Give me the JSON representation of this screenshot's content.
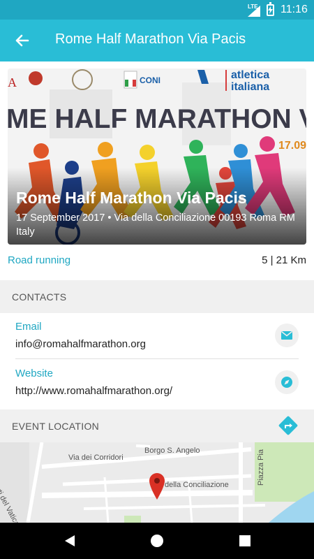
{
  "status_bar": {
    "network": "LTE",
    "time": "11:16"
  },
  "app_bar": {
    "title": "Rome Half Marathon Via Pacis"
  },
  "hero": {
    "banner_text": "ME HALF MARATHON VIA PA",
    "banner_date": "17.09",
    "logo_text_1": "atletica",
    "logo_text_2": "italiana",
    "logo_coni": "CONI",
    "event_title": "Rome Half Marathon Via Pacis",
    "event_details": "17 September 2017 • Via della Conciliazione 00193 Roma RM Italy"
  },
  "event_info": {
    "category": "Road running",
    "distances": "5 | 21 Km"
  },
  "contacts": {
    "header": "CONTACTS",
    "email": {
      "label": "Email",
      "value": "info@romahalfmarathon.org"
    },
    "website": {
      "label": "Website",
      "value": "http://www.romahalfmarathon.org/"
    }
  },
  "location": {
    "header": "EVENT LOCATION"
  },
  "map": {
    "streets": {
      "borgo_angelo": "Borgo S. Angelo",
      "corridori": "Via dei Corridori",
      "vaticano": "Orti del Vaticano",
      "conciliazione": "della Conciliazione",
      "piazza_pia": "Piazza Pia"
    }
  },
  "colors": {
    "accent": "#29bdd6",
    "status_bar": "#1fa7c2",
    "pin": "#d93025"
  },
  "icons": {
    "back": "arrow-back-icon",
    "email": "envelope-icon",
    "website": "compass-icon",
    "directions": "directions-icon",
    "pin": "map-pin-icon"
  }
}
